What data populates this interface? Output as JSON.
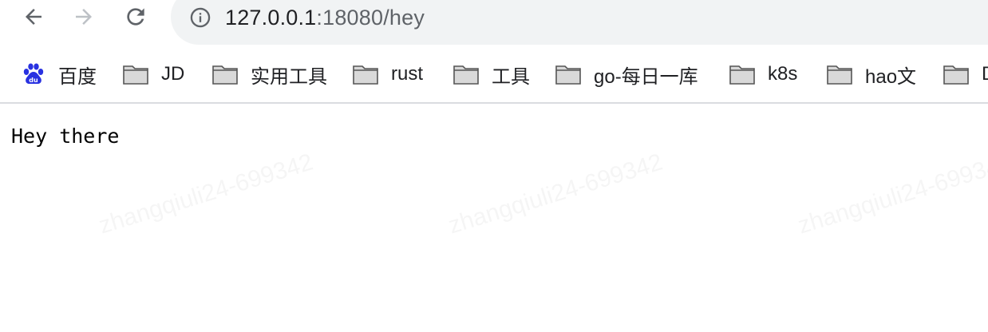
{
  "toolbar": {
    "back_icon": "arrow-left-icon",
    "forward_icon": "arrow-right-icon",
    "reload_icon": "reload-icon",
    "info_icon": "info-circle-icon"
  },
  "omnibox": {
    "host": "127.0.0.1",
    "rest": ":18080/hey"
  },
  "bookmarks": [
    {
      "label": "百度",
      "icon": "baidu-paw-icon"
    },
    {
      "label": "JD",
      "icon": "folder-icon"
    },
    {
      "label": "实用工具",
      "icon": "folder-icon"
    },
    {
      "label": "rust",
      "icon": "folder-icon"
    },
    {
      "label": "工具",
      "icon": "folder-icon"
    },
    {
      "label": "go-每日一库",
      "icon": "folder-icon"
    },
    {
      "label": "k8s",
      "icon": "folder-icon"
    },
    {
      "label": "hao文",
      "icon": "folder-icon"
    },
    {
      "label": "D",
      "icon": "folder-icon"
    }
  ],
  "page": {
    "text": "Hey there"
  },
  "watermark": {
    "text": "zhangqiuli24-699342"
  },
  "colors": {
    "omnibox_bg": "#f1f3f4",
    "icon_gray": "#5f6368",
    "baidu_blue": "#2932e1"
  }
}
